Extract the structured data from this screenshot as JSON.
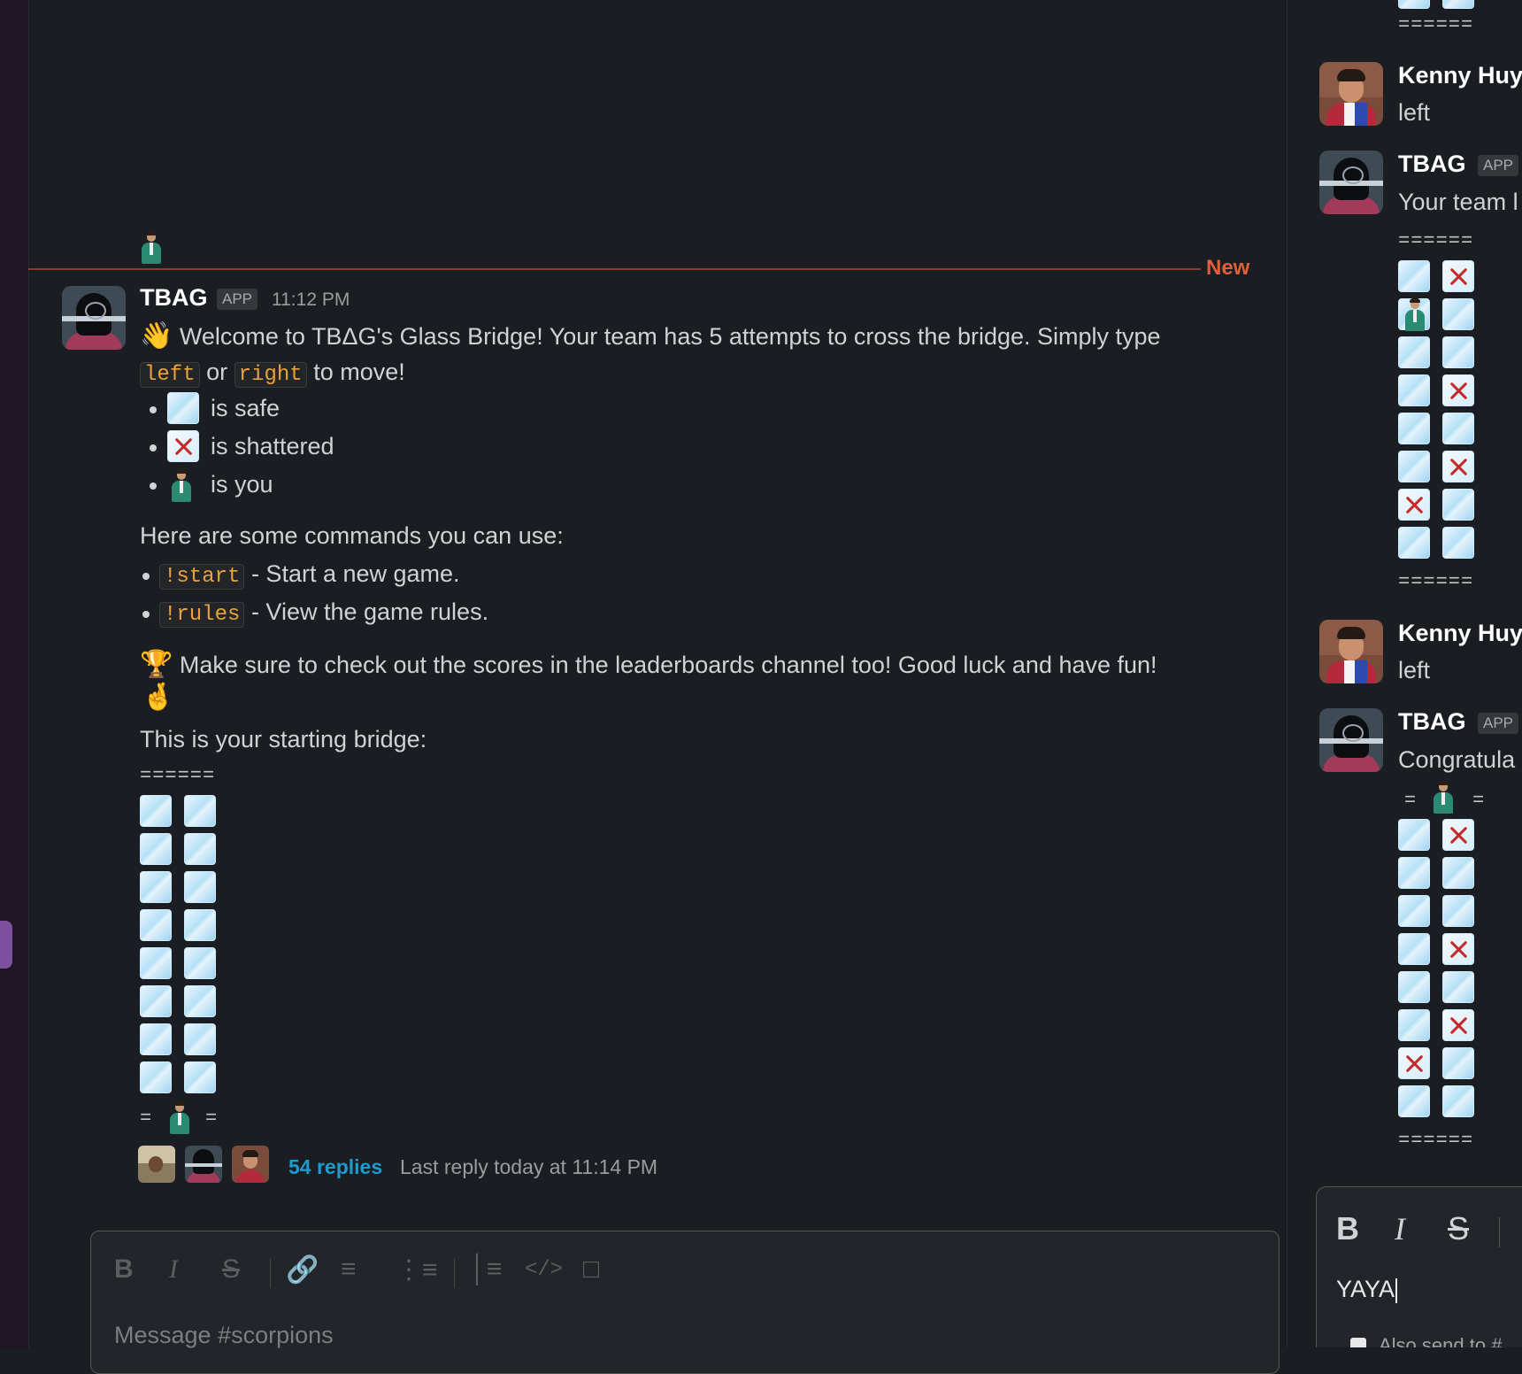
{
  "divider": {
    "new_label": "New"
  },
  "message": {
    "author": "TBAG",
    "badge": "APP",
    "time": "11:12 PM",
    "welcome_text": "Welcome to TBΔG's Glass Bridge! Your team has 5 attempts to cross the bridge. Simply type",
    "cmd_left": "left",
    "or_text": "or",
    "cmd_right": "right",
    "to_move": "to move!",
    "legend": [
      {
        "icon": "safe-tile",
        "text": "is safe"
      },
      {
        "icon": "shattered-tile",
        "text": "is shattered"
      },
      {
        "icon": "player",
        "text": "is you"
      }
    ],
    "commands_intro": "Here are some commands you can use:",
    "commands": [
      {
        "code": "!start",
        "desc": "- Start a new game."
      },
      {
        "code": "!rules",
        "desc": "- View the game rules."
      }
    ],
    "scores_text": "Make sure to check out the scores in the leaderboards channel too! Good luck and have fun!",
    "bridge_intro": "This is your starting bridge:",
    "bridge_top": "======",
    "bridge_bottom_left": "=",
    "bridge_bottom_right": "=",
    "bridge_rows": 8,
    "thread": {
      "replies": "54 replies",
      "last_reply": "Last reply today at 11:14 PM"
    }
  },
  "composer": {
    "placeholder": "Message #scorpions",
    "toolbar_icons": [
      "bold-icon",
      "italic-icon",
      "strike-icon",
      "link-icon",
      "ordered-list-icon",
      "bullet-list-icon",
      "blockquote-icon",
      "code-icon",
      "code-block-icon"
    ]
  },
  "thread_panel": {
    "top_eq": "======",
    "messages": [
      {
        "author": "Kenny Huy",
        "text": "left"
      },
      {
        "author": "TBAG",
        "badge": "APP",
        "text": "Your team l"
      },
      {
        "author": "Kenny Huy",
        "text": "left"
      },
      {
        "author": "TBAG",
        "badge": "APP",
        "text": "Congratula"
      }
    ],
    "bridge1": {
      "top": "======",
      "bottom": "======",
      "rows": [
        [
          "safe",
          "x"
        ],
        [
          "player",
          "safe"
        ],
        [
          "safe",
          "safe"
        ],
        [
          "safe",
          "x"
        ],
        [
          "safe",
          "safe"
        ],
        [
          "safe",
          "x"
        ],
        [
          "x",
          "safe"
        ],
        [
          "safe",
          "safe"
        ]
      ]
    },
    "bridge2": {
      "top_left": "=",
      "top_right": "=",
      "bottom": "======",
      "rows": [
        [
          "safe",
          "x"
        ],
        [
          "safe",
          "safe"
        ],
        [
          "safe",
          "safe"
        ],
        [
          "safe",
          "x"
        ],
        [
          "safe",
          "safe"
        ],
        [
          "safe",
          "x"
        ],
        [
          "x",
          "safe"
        ],
        [
          "safe",
          "safe"
        ]
      ]
    },
    "composer": {
      "input_value": "YAYA",
      "toolbar_icons": [
        "bold-icon",
        "italic-icon",
        "strike-icon"
      ],
      "checkbox_label": "Also send to #"
    }
  }
}
